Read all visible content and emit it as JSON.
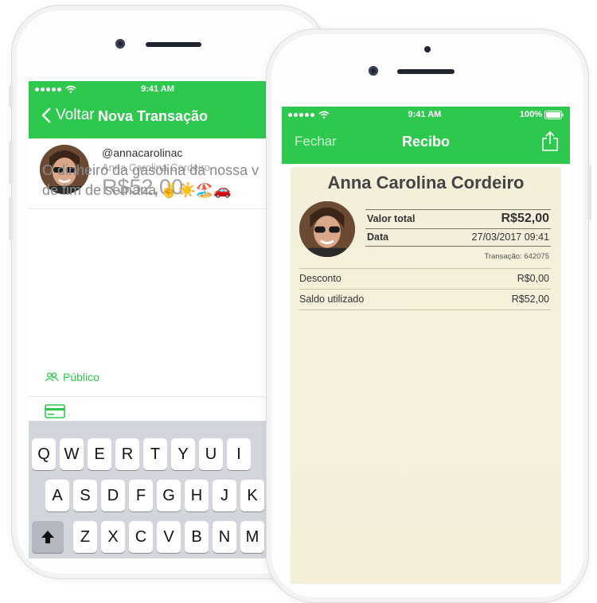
{
  "colors": {
    "accent": "#2ec84f",
    "paper": "#f4efd9"
  },
  "left_phone": {
    "status": {
      "time": "9:41 AM"
    },
    "nav": {
      "back_label": "Voltar",
      "title": "Nova Transação",
      "back_icon": "chevron-left-icon"
    },
    "transaction": {
      "username": "@annacarolinac",
      "full_name": "Anna Carolina Cordeiro",
      "amount": "R$52,00",
      "message_line1": "O dinheiro da gasolina da nossa v",
      "message_line2": "de fim de semana ✌️☀️🏖️🚗"
    },
    "privacy": {
      "label": "Público",
      "icon": "people-icon"
    },
    "payment_icon": "credit-card-icon",
    "keyboard": {
      "row1": [
        "Q",
        "W",
        "E",
        "R",
        "T",
        "Y",
        "U",
        "I"
      ],
      "row2": [
        "A",
        "S",
        "D",
        "F",
        "G",
        "H",
        "J",
        "K"
      ],
      "row3": [
        "Z",
        "X",
        "C",
        "V",
        "B",
        "N",
        "M"
      ],
      "shift_icon": "shift-icon"
    }
  },
  "right_phone": {
    "status": {
      "time": "9:41 AM",
      "battery": "100%"
    },
    "nav": {
      "close_label": "Fechar",
      "title": "Recibo",
      "share_icon": "share-icon"
    },
    "receipt": {
      "name": "Anna Carolina Cordeiro",
      "total_label": "Valor total",
      "total_value": "R$52,00",
      "date_label": "Data",
      "date_value": "27/03/2017 09:41",
      "transaction": "Transação: 642075",
      "discount_label": "Desconto",
      "discount_value": "R$0,00",
      "balance_label": "Saldo utilizado",
      "balance_value": "R$52,00"
    }
  }
}
